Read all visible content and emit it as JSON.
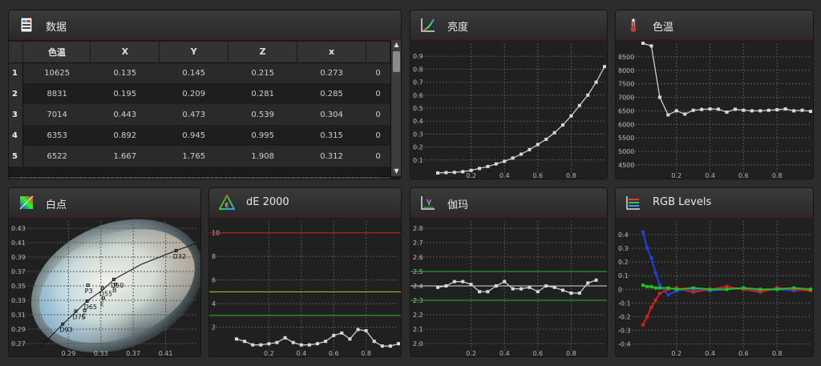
{
  "panels": {
    "data": {
      "title": "数据"
    },
    "luminance": {
      "title": "亮度"
    },
    "cct": {
      "title": "色温"
    },
    "whitepoint": {
      "title": "白点"
    },
    "de2000": {
      "title": "dE 2000"
    },
    "gamma": {
      "title": "伽玛"
    },
    "rgb": {
      "title": "RGB Levels"
    }
  },
  "table": {
    "headers": [
      "色温",
      "X",
      "Y",
      "Z",
      "x",
      ""
    ],
    "rows": [
      {
        "n": "1",
        "cells": [
          "10625",
          "0.135",
          "0.145",
          "0.215",
          "0.273",
          "0"
        ]
      },
      {
        "n": "2",
        "cells": [
          "8831",
          "0.195",
          "0.209",
          "0.281",
          "0.285",
          "0"
        ]
      },
      {
        "n": "3",
        "cells": [
          "7014",
          "0.443",
          "0.473",
          "0.539",
          "0.304",
          "0"
        ]
      },
      {
        "n": "4",
        "cells": [
          "6353",
          "0.892",
          "0.945",
          "0.995",
          "0.315",
          "0"
        ]
      },
      {
        "n": "5",
        "cells": [
          "6522",
          "1.667",
          "1.765",
          "1.908",
          "0.312",
          "0"
        ]
      }
    ]
  },
  "colors": {
    "grid": "#555555",
    "line": "#d8d8d8",
    "red": "#d02020",
    "green": "#20c020",
    "blue": "#2040e0",
    "yellow": "#c8c020"
  },
  "chart_data": [
    {
      "id": "luminance",
      "type": "line",
      "title": "亮度",
      "xlim": [
        0,
        1
      ],
      "ylim": [
        0,
        1
      ],
      "xticks": [
        0.2,
        0.4,
        0.6,
        0.8
      ],
      "xtick_labels": [
        "0.2",
        "0.4",
        "0.6",
        "0.8"
      ],
      "yticks": [
        0.1,
        0.2,
        0.3,
        0.4,
        0.5,
        0.6,
        0.7,
        0.8,
        0.9
      ],
      "ytick_labels": [
        "0.1",
        "0.2",
        "0.3",
        "0.4",
        "0.5",
        "0.6",
        "0.7",
        "0.8",
        "0.9"
      ],
      "series": [
        {
          "x": [
            0,
            0.05,
            0.1,
            0.15,
            0.2,
            0.25,
            0.3,
            0.35,
            0.4,
            0.45,
            0.5,
            0.55,
            0.6,
            0.65,
            0.7,
            0.75,
            0.8,
            0.85,
            0.9,
            0.95,
            1.0
          ],
          "y": [
            0.0,
            0.003,
            0.005,
            0.01,
            0.02,
            0.035,
            0.05,
            0.07,
            0.09,
            0.115,
            0.145,
            0.18,
            0.22,
            0.26,
            0.31,
            0.37,
            0.44,
            0.52,
            0.6,
            0.7,
            0.82
          ]
        }
      ]
    },
    {
      "id": "cct",
      "type": "line",
      "title": "色温",
      "xlim": [
        0,
        1
      ],
      "ylim": [
        4200,
        9000
      ],
      "xticks": [
        0.2,
        0.4,
        0.6,
        0.8
      ],
      "xtick_labels": [
        "0.2",
        "0.4",
        "0.6",
        "0.8"
      ],
      "yticks": [
        4500,
        5000,
        5500,
        6000,
        6500,
        7000,
        7500,
        8000,
        8500
      ],
      "ytick_labels": [
        "4500",
        "5000",
        "5500",
        "6000",
        "6500",
        "7000",
        "7500",
        "8000",
        "8500"
      ],
      "series": [
        {
          "x": [
            0,
            0.05,
            0.1,
            0.15,
            0.2,
            0.25,
            0.3,
            0.35,
            0.4,
            0.45,
            0.5,
            0.55,
            0.6,
            0.65,
            0.7,
            0.75,
            0.8,
            0.85,
            0.9,
            0.95,
            1.0
          ],
          "y": [
            9000,
            8900,
            7000,
            6350,
            6500,
            6380,
            6520,
            6550,
            6570,
            6560,
            6450,
            6560,
            6520,
            6500,
            6500,
            6520,
            6540,
            6570,
            6500,
            6520,
            6480
          ]
        }
      ]
    },
    {
      "id": "whitepoint",
      "type": "scatter",
      "title": "白点",
      "xlim": [
        0.25,
        0.45
      ],
      "ylim": [
        0.26,
        0.44
      ],
      "xticks": [
        0.29,
        0.33,
        0.37,
        0.41
      ],
      "xtick_labels": [
        "0.29",
        "0.33",
        "0.37",
        "0.41"
      ],
      "yticks": [
        0.27,
        0.29,
        0.31,
        0.33,
        0.35,
        0.37,
        0.39,
        0.41,
        0.43
      ],
      "ytick_labels": [
        "0.27",
        "0.29",
        "0.31",
        "0.33",
        "0.35",
        "0.37",
        "0.39",
        "0.41",
        "0.43"
      ],
      "labels": [
        {
          "t": "D93",
          "x": 0.283,
          "y": 0.297
        },
        {
          "t": "D75",
          "x": 0.299,
          "y": 0.315
        },
        {
          "t": "C",
          "x": 0.31,
          "y": 0.316
        },
        {
          "t": "D65",
          "x": 0.313,
          "y": 0.329
        },
        {
          "t": "E",
          "x": 0.333,
          "y": 0.333
        },
        {
          "t": "P3",
          "x": 0.314,
          "y": 0.351
        },
        {
          "t": "D55",
          "x": 0.332,
          "y": 0.347
        },
        {
          "t": "D50",
          "x": 0.346,
          "y": 0.359
        },
        {
          "t": "B",
          "x": 0.348,
          "y": 0.352
        },
        {
          "t": "D32",
          "x": 0.423,
          "y": 0.399
        }
      ]
    },
    {
      "id": "de2000",
      "type": "line",
      "title": "dE 2000",
      "xlim": [
        0,
        1
      ],
      "ylim": [
        0,
        11
      ],
      "xticks": [
        0.2,
        0.4,
        0.6,
        0.8
      ],
      "xtick_labels": [
        "0.2",
        "0.4",
        "0.6",
        "0.8"
      ],
      "yticks": [
        2,
        4,
        6,
        8,
        10
      ],
      "ytick_labels": [
        "2",
        "4",
        "6",
        "8",
        "10"
      ],
      "thresholds": [
        {
          "y": 10,
          "color": "#d02020"
        },
        {
          "y": 5,
          "color": "#c8c020"
        },
        {
          "y": 3,
          "color": "#20c020"
        }
      ],
      "series": [
        {
          "x": [
            0,
            0.05,
            0.1,
            0.15,
            0.2,
            0.25,
            0.3,
            0.35,
            0.4,
            0.45,
            0.5,
            0.55,
            0.6,
            0.65,
            0.7,
            0.75,
            0.8,
            0.85,
            0.9,
            0.95,
            1.0
          ],
          "y": [
            1.0,
            0.8,
            0.5,
            0.5,
            0.6,
            0.7,
            1.1,
            0.7,
            0.5,
            0.5,
            0.6,
            0.8,
            1.3,
            1.5,
            1.0,
            1.8,
            1.7,
            0.8,
            0.4,
            0.4,
            0.6
          ]
        }
      ]
    },
    {
      "id": "gamma",
      "type": "line",
      "title": "伽玛",
      "xlim": [
        0,
        1
      ],
      "ylim": [
        1.95,
        2.85
      ],
      "xticks": [
        0.2,
        0.4,
        0.6,
        0.8
      ],
      "xtick_labels": [
        "0.2",
        "0.4",
        "0.6",
        "0.8"
      ],
      "yticks": [
        2.0,
        2.1,
        2.2,
        2.3,
        2.4,
        2.5,
        2.6,
        2.7,
        2.8
      ],
      "ytick_labels": [
        "2.0",
        "2.1",
        "2.2",
        "2.3",
        "2.4",
        "2.5",
        "2.6",
        "2.7",
        "2.8"
      ],
      "thresholds": [
        {
          "y": 2.5,
          "color": "#20c020"
        },
        {
          "y": 2.3,
          "color": "#20c020"
        },
        {
          "y": 2.4,
          "color": "#d8d8d8"
        }
      ],
      "series": [
        {
          "x": [
            0.0,
            0.05,
            0.1,
            0.15,
            0.2,
            0.25,
            0.3,
            0.35,
            0.4,
            0.45,
            0.5,
            0.55,
            0.6,
            0.65,
            0.7,
            0.75,
            0.8,
            0.85,
            0.9,
            0.95
          ],
          "y": [
            2.39,
            2.4,
            2.43,
            2.43,
            2.41,
            2.36,
            2.36,
            2.4,
            2.43,
            2.38,
            2.38,
            2.39,
            2.36,
            2.4,
            2.39,
            2.37,
            2.35,
            2.35,
            2.42,
            2.44
          ]
        }
      ]
    },
    {
      "id": "rgb",
      "type": "line",
      "title": "RGB Levels",
      "xlim": [
        0,
        1
      ],
      "ylim": [
        -0.45,
        0.5
      ],
      "xticks": [
        0.2,
        0.4,
        0.6,
        0.8
      ],
      "xtick_labels": [
        "0.2",
        "0.4",
        "0.6",
        "0.8"
      ],
      "yticks": [
        -0.4,
        -0.3,
        -0.2,
        -0.1,
        0,
        0.1,
        0.2,
        0.3,
        0.4
      ],
      "ytick_labels": [
        "-0.4",
        "-0.3",
        "-0.2",
        "-0.1",
        "0",
        "0.1",
        "0.2",
        "0.3",
        "0.4"
      ],
      "series": [
        {
          "color": "#2040e0",
          "x": [
            0,
            0.025,
            0.05,
            0.075,
            0.1,
            0.15,
            0.2,
            0.3,
            0.4,
            0.5,
            0.6,
            0.7,
            0.8,
            0.9,
            1.0
          ],
          "y": [
            0.42,
            0.3,
            0.23,
            0.12,
            0.03,
            -0.04,
            -0.01,
            0.0,
            -0.01,
            0.0,
            0.01,
            -0.01,
            0.0,
            -0.01,
            0.0
          ]
        },
        {
          "color": "#d02020",
          "x": [
            0,
            0.025,
            0.05,
            0.075,
            0.1,
            0.15,
            0.2,
            0.3,
            0.4,
            0.5,
            0.6,
            0.7,
            0.8,
            0.9,
            1.0
          ],
          "y": [
            -0.26,
            -0.2,
            -0.13,
            -0.08,
            -0.03,
            0.0,
            0.01,
            -0.02,
            0.0,
            0.02,
            0.0,
            -0.02,
            0.01,
            0.0,
            -0.01
          ]
        },
        {
          "color": "#20c020",
          "x": [
            0,
            0.025,
            0.05,
            0.075,
            0.1,
            0.15,
            0.2,
            0.3,
            0.4,
            0.5,
            0.6,
            0.7,
            0.8,
            0.9,
            1.0
          ],
          "y": [
            0.03,
            0.02,
            0.02,
            0.01,
            0.01,
            0.01,
            0.0,
            0.01,
            0.0,
            0.0,
            0.01,
            0.0,
            0.0,
            0.01,
            0.0
          ]
        }
      ]
    }
  ]
}
